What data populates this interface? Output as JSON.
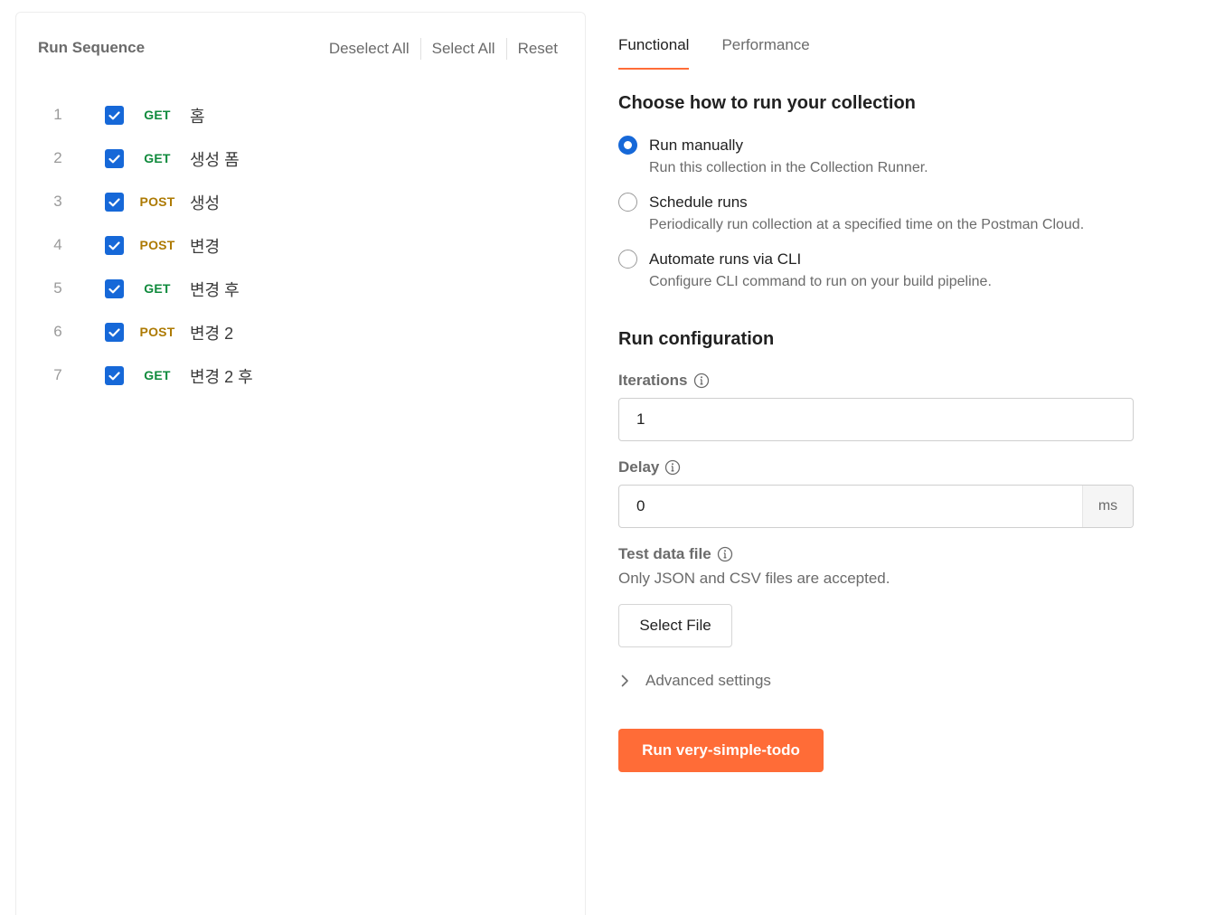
{
  "run_sequence": {
    "title": "Run Sequence",
    "actions": {
      "deselect_all": "Deselect All",
      "select_all": "Select All",
      "reset": "Reset"
    },
    "items": [
      {
        "index": "1",
        "method": "GET",
        "name": "홈",
        "checked": true
      },
      {
        "index": "2",
        "method": "GET",
        "name": "생성 폼",
        "checked": true
      },
      {
        "index": "3",
        "method": "POST",
        "name": "생성",
        "checked": true
      },
      {
        "index": "4",
        "method": "POST",
        "name": "변경",
        "checked": true
      },
      {
        "index": "5",
        "method": "GET",
        "name": "변경 후",
        "checked": true
      },
      {
        "index": "6",
        "method": "POST",
        "name": "변경 2",
        "checked": true
      },
      {
        "index": "7",
        "method": "GET",
        "name": "변경 2 후",
        "checked": true
      }
    ],
    "method_colors": {
      "GET": "#0f8a3c",
      "POST": "#ad7a03"
    }
  },
  "tabs": [
    {
      "label": "Functional",
      "active": true
    },
    {
      "label": "Performance",
      "active": false
    }
  ],
  "run_mode": {
    "title": "Choose how to run your collection",
    "options": [
      {
        "label": "Run manually",
        "description": "Run this collection in the Collection Runner.",
        "selected": true
      },
      {
        "label": "Schedule runs",
        "description": "Periodically run collection at a specified time on the Postman Cloud.",
        "selected": false
      },
      {
        "label": "Automate runs via CLI",
        "description": "Configure CLI command to run on your build pipeline.",
        "selected": false
      }
    ]
  },
  "config": {
    "title": "Run configuration",
    "iterations": {
      "label": "Iterations",
      "value": "1"
    },
    "delay": {
      "label": "Delay",
      "value": "0",
      "unit": "ms"
    },
    "test_data": {
      "label": "Test data file",
      "hint": "Only JSON and CSV files are accepted.",
      "button": "Select File"
    },
    "advanced_label": "Advanced settings"
  },
  "run_button": "Run very-simple-todo",
  "colors": {
    "accent": "#ff6c37",
    "checkbox": "#1668d8",
    "radio": "#1668d8"
  }
}
